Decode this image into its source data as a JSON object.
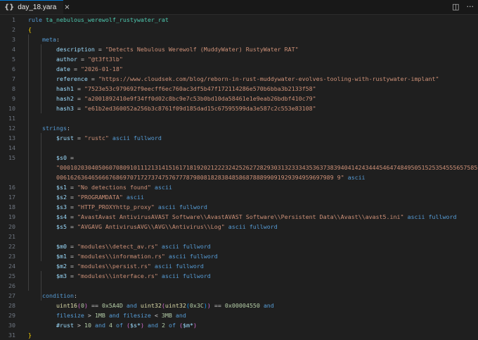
{
  "tab": {
    "icon": "{}",
    "title": "day_18.yara",
    "close": "×"
  },
  "actions": {
    "split_icon": "split-editor-icon",
    "more_icon": "more-actions-icon",
    "split_glyph": "◫",
    "more_glyph": "···"
  },
  "editor": {
    "lines": [
      [
        "1",
        "<span class='k'>rule</span> <span class='n'>ta_nebulous_werewolf_rustywater_rat</span>"
      ],
      [
        "2",
        "<span class='b1'>{</span>"
      ],
      [
        "3",
        "    <span class='k'>meta</span><span class='p'>:</span>"
      ],
      [
        "4",
        "        <span class='v'>description</span> = <span class='s'>\"Detects Nebulous Werewolf (MuddyWater) RustyWater RAT\"</span>"
      ],
      [
        "5",
        "        <span class='v'>author</span> = <span class='s'>\"@t3ft3lb\"</span>"
      ],
      [
        "6",
        "        <span class='v'>date</span> = <span class='s'>\"2026-01-18\"</span>"
      ],
      [
        "7",
        "        <span class='v'>reference</span> = <span class='s'>\"https://www.cloudsek.com/blog/reborn-in-rust-muddywater-evolves-tooling-with-rustywater-implant\"</span>"
      ],
      [
        "8",
        "        <span class='v'>hash1</span> = <span class='s'>\"7523e53c979692f9eecff6ec760ac3df5b47f172114286e570b6bba3b2133f58\"</span>"
      ],
      [
        "9",
        "        <span class='v'>hash2</span> = <span class='s'>\"a2001892410e9f34ff0d02c8bc9e7c53b0bd10da58461e1e9eab26bdbf410c79\"</span>"
      ],
      [
        "10",
        "        <span class='v'>hash3</span> = <span class='s'>\"e61b2ed360052a256b3c8761f09d185dad15c67595599da3e587c2c553e83108\"</span>"
      ],
      [
        "11",
        ""
      ],
      [
        "12",
        "    <span class='k'>strings</span><span class='p'>:</span>"
      ],
      [
        "13",
        "        <span class='v'>$rust</span> = <span class='s'>\"rustc\"</span> <span class='k'>ascii</span> <span class='k'>fullword</span>"
      ],
      [
        "14",
        ""
      ],
      [
        "15",
        "        <span class='v'>$s0</span> ="
      ],
      [
        "",
        "        <span class='s'>\"0001020304050607080910111213141516171819202122232425262728293031323334353637383940414243444546474849505152535455565758596</span>"
      ],
      [
        "",
        "        <span class='s'>0061626364656667686970717273747576777879808182838485868788899091929394959697989 9\"</span> <span class='k'>ascii</span>"
      ],
      [
        "16",
        "        <span class='v'>$s1</span> = <span class='s'>\"No detections found\"</span> <span class='k'>ascii</span>"
      ],
      [
        "17",
        "        <span class='v'>$s2</span> = <span class='s'>\"PROGRAMDATA\"</span> <span class='k'>ascii</span>"
      ],
      [
        "18",
        "        <span class='v'>$s3</span> = <span class='s'>\"HTTP_PROXYhttp_proxy\"</span> <span class='k'>ascii</span> <span class='k'>fullword</span>"
      ],
      [
        "19",
        "        <span class='v'>$s4</span> = <span class='s'>\"AvastAvast AntivirusAVAST Software\\\\AvastAVAST Software\\\\Persistent Data\\\\Avast\\\\avast5.ini\"</span> <span class='k'>ascii</span> <span class='k'>fullword</span>"
      ],
      [
        "20",
        "        <span class='v'>$s5</span> = <span class='s'>\"AVGAVG AntivirusAVG\\\\AVG\\\\Antivirus\\\\Log\"</span> <span class='k'>ascii</span> <span class='k'>fullword</span>"
      ],
      [
        "21",
        ""
      ],
      [
        "22",
        "        <span class='v'>$m0</span> = <span class='s'>\"modules\\\\detect_av.rs\"</span> <span class='k'>ascii</span> <span class='k'>fullword</span>"
      ],
      [
        "23",
        "        <span class='v'>$m1</span> = <span class='s'>\"modules\\\\information.rs\"</span> <span class='k'>ascii</span> <span class='k'>fullword</span>"
      ],
      [
        "24",
        "        <span class='v'>$m2</span> = <span class='s'>\"modules\\\\persist.rs\"</span> <span class='k'>ascii</span> <span class='k'>fullword</span>"
      ],
      [
        "25",
        "        <span class='v'>$m3</span> = <span class='s'>\"modules\\\\interface.rs\"</span> <span class='k'>ascii</span> <span class='k'>fullword</span>"
      ],
      [
        "26",
        ""
      ],
      [
        "27",
        "    <span class='k'>condition</span><span class='p'>:</span>"
      ],
      [
        "28",
        "        <span class='f'>uint16</span><span class='b2'>(</span><span class='num'>0</span><span class='b2'>)</span> == <span class='num'>0x5A4D</span> <span class='k'>and</span> <span class='f'>uint32</span><span class='b2'>(</span><span class='f'>uint32</span><span class='b3'>(</span><span class='num'>0x3C</span><span class='b3'>)</span><span class='b2'>)</span> == <span class='num'>0x00004550</span> <span class='k'>and</span>"
      ],
      [
        "29",
        "        <span class='k'>filesize</span> &gt; <span class='num'>1MB</span> <span class='k'>and</span> <span class='k'>filesize</span> &lt; <span class='num'>3MB</span> <span class='k'>and</span>"
      ],
      [
        "30",
        "        <span class='v'>#rust</span> &gt; <span class='num'>10</span> <span class='k'>and</span> <span class='num'>4</span> <span class='k'>of</span> <span class='b2'>(</span><span class='v'>$s*</span><span class='b2'>)</span> <span class='k'>and</span> <span class='num'>2</span> <span class='k'>of</span> <span class='b2'>(</span><span class='v'>$m*</span><span class='b2'>)</span>"
      ],
      [
        "31",
        "<span class='b1'>}</span>"
      ]
    ]
  }
}
